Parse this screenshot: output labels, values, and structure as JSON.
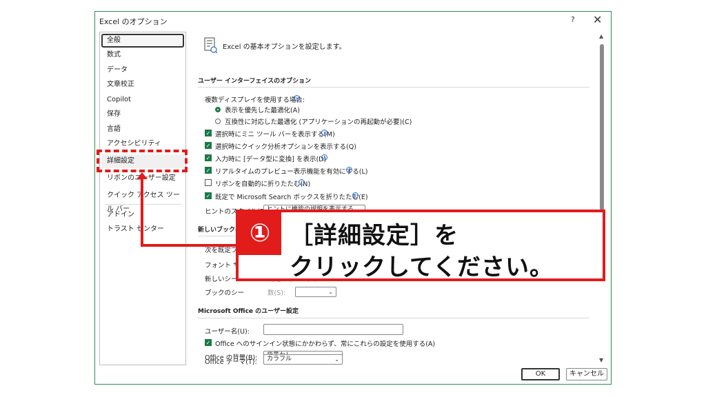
{
  "window": {
    "title": "Excel のオプション",
    "help_glyph": "?",
    "close_glyph": "✕"
  },
  "sidebar": {
    "items": [
      {
        "label": "全般"
      },
      {
        "label": "数式"
      },
      {
        "label": "データ"
      },
      {
        "label": "文章校正"
      },
      {
        "label": "Copilot"
      },
      {
        "label": "保存"
      },
      {
        "label": "言語"
      },
      {
        "label": "アクセシビリティ"
      },
      {
        "label": "詳細設定"
      },
      {
        "label": "リボンのユーザー設定"
      },
      {
        "label": "クイック アクセス ツール バー"
      },
      {
        "label": "アドイン"
      },
      {
        "label": "トラスト センター"
      }
    ]
  },
  "content": {
    "header_text": "Excel の基本オプションを設定します。",
    "ui_section": {
      "title": "ユーザー インターフェイスのオプション",
      "multi_display_label": "複数ディスプレイを使用する場合:",
      "radio_display": "表示を優先した最適化(A)",
      "radio_compat": "互換性に対応した最適化 (アプリケーションの再起動が必要)(C)",
      "checks": [
        {
          "label": "選択時にミニ ツール バーを表示する(M)",
          "checked": true
        },
        {
          "label": "選択時にクイック分析オプションを表示する(Q)",
          "checked": true
        },
        {
          "label": "入力時に [データ型に変換] を表示(D)",
          "checked": true
        },
        {
          "label": "リアルタイムのプレビュー表示機能を有効にする(L)",
          "checked": true
        },
        {
          "label": "リボンを自動的に折りたたむ(N)",
          "checked": false
        },
        {
          "label": "既定で Microsoft Search ボックスを折りたたむ(E)",
          "checked": true
        }
      ],
      "hint_style_label": "ヒントのスタイル(R):",
      "hint_style_value": "ヒントに機能の説明を表示する"
    },
    "new_book_section": {
      "title": "新しいブックの",
      "default_font_label": "次を既定フ",
      "font_size_label": "フォント サイ",
      "new_sheet_view_label": "新しいシート",
      "new_sheet_view_suffix": "既定のビュー(V):",
      "sheet_count_label": "ブックのシー",
      "sheet_count_suffix": "数(S):"
    },
    "office_section": {
      "title": "Microsoft Office のユーザー設定",
      "username_label": "ユーザー名(U):",
      "username_value": "",
      "signin_check_label": "Office へのサインイン状態にかかわらず、常にこれらの設定を使用する(A)",
      "signin_checked": true,
      "background_label": "Office の背景(B):",
      "background_value": "背景なし",
      "theme_label": "Office テーマ(T):",
      "theme_value": "カラフル"
    }
  },
  "footer": {
    "ok_label": "OK",
    "cancel_label": "キャンセル"
  },
  "callout": {
    "number": "①",
    "line1": "［詳細設定］を",
    "line2": "クリックしてください。"
  },
  "colors": {
    "accent_green": "#1b7a45",
    "annotation_red": "#e21b1b",
    "info_blue": "#2b6cd3"
  }
}
